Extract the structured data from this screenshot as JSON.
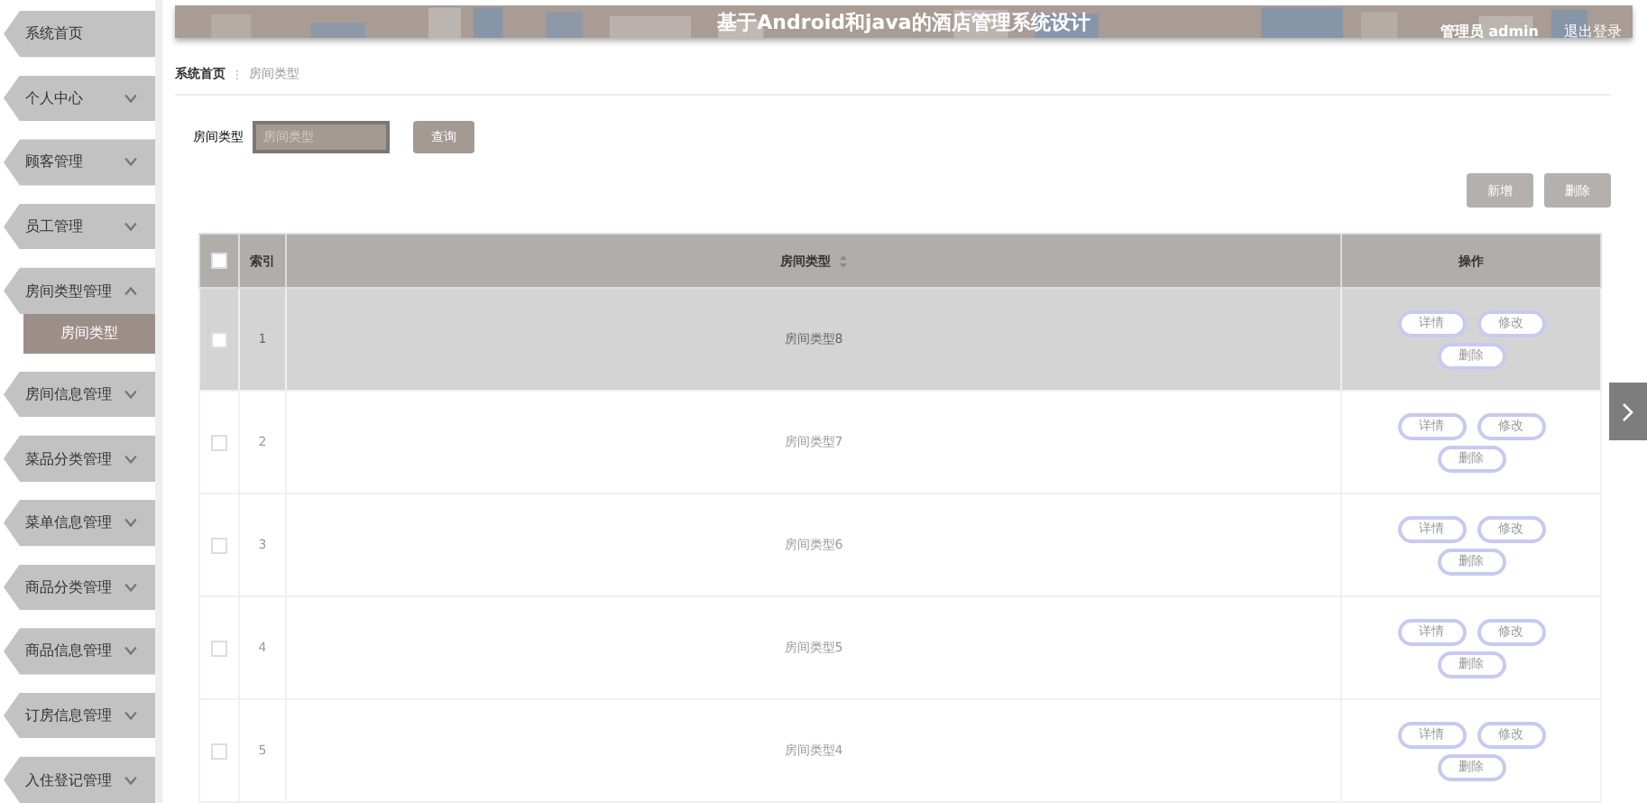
{
  "sidebar": {
    "items": [
      {
        "label": "系统首页",
        "kind": "link"
      },
      {
        "label": "个人中心",
        "kind": "menu",
        "expanded": false
      },
      {
        "label": "顾客管理",
        "kind": "menu",
        "expanded": false
      },
      {
        "label": "员工管理",
        "kind": "menu",
        "expanded": false
      },
      {
        "label": "房间类型管理",
        "kind": "menu",
        "expanded": true,
        "children": [
          {
            "label": "房间类型",
            "selected": true
          }
        ]
      },
      {
        "label": "房间信息管理",
        "kind": "menu",
        "expanded": false
      },
      {
        "label": "菜品分类管理",
        "kind": "menu",
        "expanded": false
      },
      {
        "label": "菜单信息管理",
        "kind": "menu",
        "expanded": false
      },
      {
        "label": "商品分类管理",
        "kind": "menu",
        "expanded": false
      },
      {
        "label": "商品信息管理",
        "kind": "menu",
        "expanded": false
      },
      {
        "label": "订房信息管理",
        "kind": "menu",
        "expanded": false
      },
      {
        "label": "入住登记管理",
        "kind": "menu",
        "expanded": false
      }
    ]
  },
  "header": {
    "title": "基于Android和java的酒店管理系统设计",
    "user": "管理员 admin",
    "logout": "退出登录"
  },
  "breadcrumb": [
    {
      "label": "系统首页",
      "current": false
    },
    {
      "label": "房间类型",
      "current": true
    }
  ],
  "search": {
    "label": "房间类型",
    "placeholder": "房间类型",
    "button": "查询"
  },
  "actions": [
    "新增",
    "删除"
  ],
  "table": {
    "all_checked": false,
    "columns": [
      {
        "kind": "check"
      },
      {
        "label": "索引",
        "kind": "text"
      },
      {
        "label": "房间类型",
        "kind": "sort"
      },
      {
        "label": "操作",
        "kind": "text"
      }
    ],
    "rows": [
      {
        "index": "1",
        "type": "房间类型8",
        "highlighted": true,
        "checked": false,
        "buttons": [
          "详情",
          "修改",
          "删除"
        ]
      },
      {
        "index": "2",
        "type": "房间类型7",
        "highlighted": false,
        "checked": false,
        "buttons": [
          "详情",
          "修改",
          "删除"
        ]
      },
      {
        "index": "3",
        "type": "房间类型6",
        "highlighted": false,
        "checked": false,
        "buttons": [
          "详情",
          "修改",
          "删除"
        ]
      },
      {
        "index": "4",
        "type": "房间类型5",
        "highlighted": false,
        "checked": false,
        "buttons": [
          "详情",
          "修改",
          "删除"
        ]
      },
      {
        "index": "5",
        "type": "房间类型4",
        "highlighted": false,
        "checked": false,
        "buttons": [
          "详情",
          "修改",
          "删除"
        ]
      }
    ]
  }
}
